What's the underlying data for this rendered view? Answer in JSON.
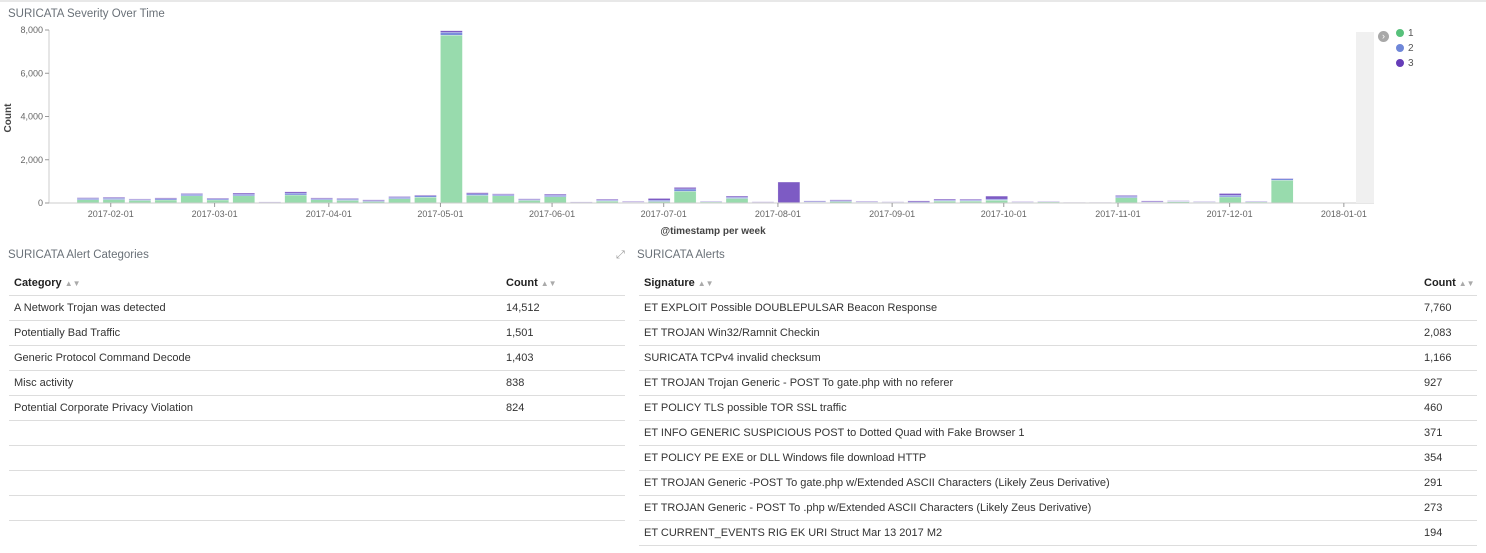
{
  "severity_panel": {
    "title": "SURICATA Severity Over Time"
  },
  "categories_panel": {
    "title": "SURICATA Alert Categories",
    "headers": {
      "category": "Category",
      "count": "Count"
    },
    "rows": [
      {
        "category": "A Network Trojan was detected",
        "count": "14,512"
      },
      {
        "category": "Potentially Bad Traffic",
        "count": "1,501"
      },
      {
        "category": "Generic Protocol Command Decode",
        "count": "1,403"
      },
      {
        "category": "Misc activity",
        "count": "838"
      },
      {
        "category": "Potential Corporate Privacy Violation",
        "count": "824"
      }
    ]
  },
  "alerts_panel": {
    "title": "SURICATA Alerts",
    "headers": {
      "signature": "Signature",
      "count": "Count"
    },
    "rows": [
      {
        "signature": "ET EXPLOIT Possible DOUBLEPULSAR Beacon Response",
        "count": "7,760"
      },
      {
        "signature": "ET TROJAN Win32/Ramnit Checkin",
        "count": "2,083"
      },
      {
        "signature": "SURICATA TCPv4 invalid checksum",
        "count": "1,166"
      },
      {
        "signature": "ET TROJAN Trojan Generic - POST To gate.php with no referer",
        "count": "927"
      },
      {
        "signature": "ET POLICY TLS possible TOR SSL traffic",
        "count": "460"
      },
      {
        "signature": "ET INFO GENERIC SUSPICIOUS POST to Dotted Quad with Fake Browser 1",
        "count": "371"
      },
      {
        "signature": "ET POLICY PE EXE or DLL Windows file download HTTP",
        "count": "354"
      },
      {
        "signature": "ET TROJAN Generic -POST To gate.php w/Extended ASCII Characters (Likely Zeus Derivative)",
        "count": "291"
      },
      {
        "signature": "ET TROJAN Generic - POST To .php w/Extended ASCII Characters (Likely Zeus Derivative)",
        "count": "273"
      },
      {
        "signature": "ET CURRENT_EVENTS RIG EK URI Struct Mar 13 2017 M2",
        "count": "194"
      }
    ]
  },
  "legend": {
    "toggle_icon": "chevron-right-icon",
    "items": [
      {
        "label": "1",
        "color": "#57c17b"
      },
      {
        "label": "2",
        "color": "#6f87d8"
      },
      {
        "label": "3",
        "color": "#663db8"
      }
    ]
  },
  "chart_data": {
    "type": "bar",
    "stacked": true,
    "ylabel": "Count",
    "xlabel": "@timestamp per week",
    "ylim": [
      0,
      8000
    ],
    "yticks": [
      0,
      2000,
      4000,
      6000,
      8000
    ],
    "ytick_labels": [
      "0",
      "2,000",
      "4,000",
      "6,000",
      "8,000"
    ],
    "xtick_labels": [
      "2017-02-01",
      "2017-03-01",
      "2017-04-01",
      "2017-05-01",
      "2017-06-01",
      "2017-07-01",
      "2017-08-01",
      "2017-09-01",
      "2017-10-01",
      "2017-11-01",
      "2017-12-01",
      "2018-01-01"
    ],
    "xtick_week_index": [
      1.3,
      5.3,
      9.7,
      14,
      18.3,
      22.6,
      27,
      31.4,
      35.7,
      40.1,
      44.4,
      48.8
    ],
    "bar_colors": {
      "1": "#98dbad",
      "2": "#7b8cdc",
      "3": "#7d5bc4"
    },
    "series": [
      {
        "name": "1",
        "values": [
          150,
          160,
          120,
          140,
          330,
          140,
          330,
          20,
          370,
          150,
          120,
          70,
          200,
          270,
          7760,
          350,
          330,
          120,
          290,
          30,
          90,
          30,
          70,
          540,
          50,
          210,
          20,
          0,
          40,
          70,
          40,
          20,
          20,
          90,
          90,
          130,
          30,
          60,
          0,
          0,
          250,
          40,
          60,
          40,
          280,
          50,
          1050
        ]
      },
      {
        "name": "2",
        "values": [
          60,
          60,
          40,
          60,
          70,
          50,
          70,
          10,
          90,
          50,
          50,
          40,
          60,
          60,
          130,
          70,
          60,
          40,
          70,
          10,
          40,
          10,
          60,
          110,
          20,
          60,
          10,
          20,
          30,
          40,
          20,
          20,
          30,
          40,
          40,
          50,
          20,
          10,
          10,
          10,
          60,
          20,
          20,
          20,
          80,
          20,
          70
        ]
      },
      {
        "name": "3",
        "values": [
          40,
          40,
          30,
          40,
          40,
          40,
          60,
          20,
          60,
          40,
          40,
          40,
          40,
          40,
          80,
          60,
          40,
          40,
          50,
          10,
          40,
          30,
          80,
          70,
          20,
          50,
          30,
          950,
          30,
          40,
          30,
          20,
          50,
          50,
          40,
          140,
          20,
          10,
          20,
          20,
          40,
          40,
          30,
          20,
          80,
          20,
          30
        ]
      }
    ]
  }
}
